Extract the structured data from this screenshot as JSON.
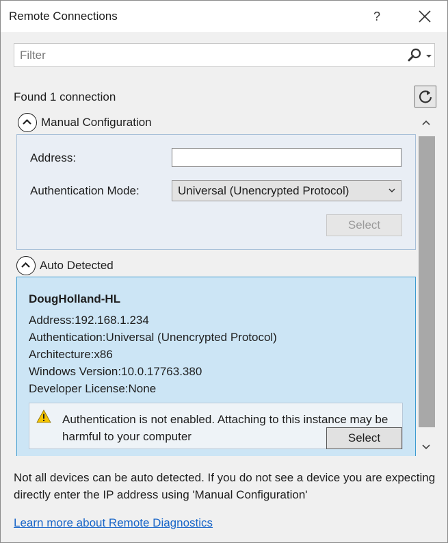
{
  "window": {
    "title": "Remote Connections",
    "help_label": "?"
  },
  "filter": {
    "placeholder": "Filter",
    "value": ""
  },
  "status": {
    "found_text": "Found 1 connection"
  },
  "manual": {
    "header": "Manual Configuration",
    "address_label": "Address:",
    "address_value": "",
    "auth_label": "Authentication Mode:",
    "auth_selected": "Universal (Unencrypted Protocol)",
    "select_label": "Select"
  },
  "auto": {
    "header": "Auto Detected",
    "device": {
      "name": "DougHolland-HL",
      "address": "Address:192.168.1.234",
      "authentication": "Authentication:Universal (Unencrypted Protocol)",
      "architecture": "Architecture:x86",
      "windows_version": "Windows Version:10.0.17763.380",
      "developer_license": "Developer License:None"
    },
    "warning": "Authentication is not enabled. Attaching to this instance may be harmful to your computer",
    "select_label": "Select"
  },
  "footer": {
    "note": "Not all devices can be auto detected. If you do not see a device you are expecting directly enter the IP address using 'Manual Configuration'",
    "link": "Learn more about Remote Diagnostics"
  },
  "colors": {
    "accent_link": "#1a66c8",
    "detected_bg": "#cce5f5",
    "detected_border": "#3c9bd1",
    "warning_yellow": "#f5c400"
  },
  "icons": [
    "close-icon",
    "search-icon",
    "chevron-down-icon",
    "refresh-icon",
    "collapse-up-icon",
    "warning-icon",
    "scroll-up-icon",
    "scroll-down-icon"
  ]
}
